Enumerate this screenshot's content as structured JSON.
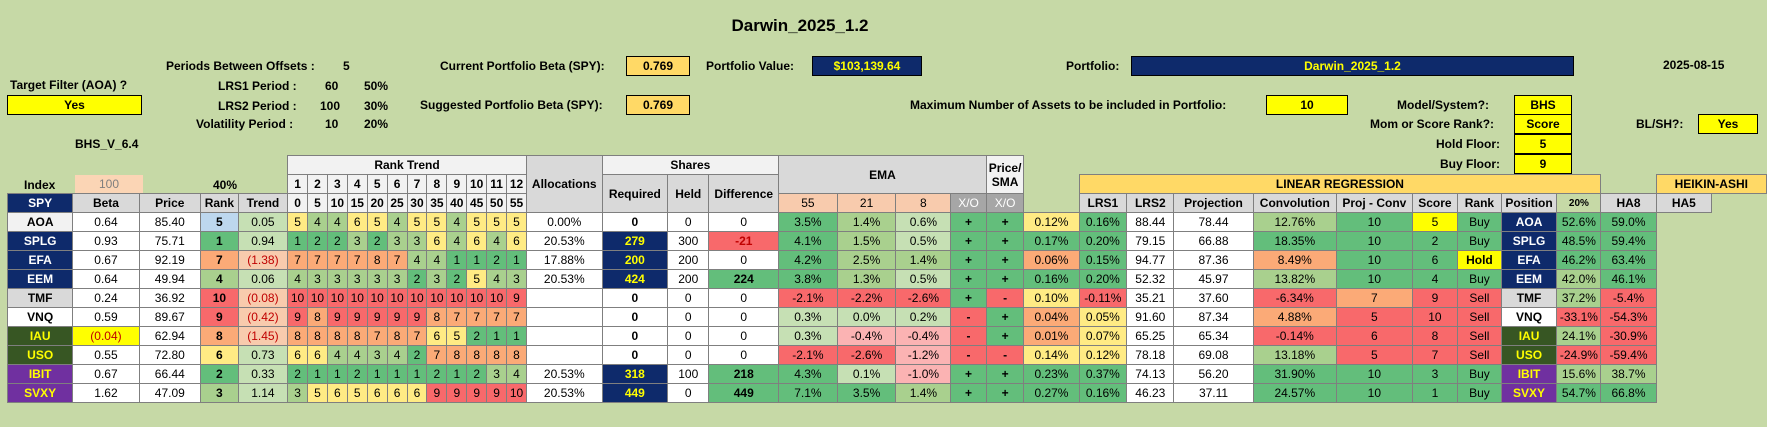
{
  "title": "Darwin_2025_1.2",
  "date": "2025-08-15",
  "target_filter_label": "Target Filter (AOA) ?",
  "target_filter_value": "Yes",
  "version": "BHS_V_6.4",
  "periods_between_offsets_label": "Periods Between Offsets :",
  "periods_between_offsets_value": "5",
  "lrs1_label": "LRS1 Period :",
  "lrs1_period": "60",
  "lrs1_pct": "50%",
  "lrs2_label": "LRS2 Period :",
  "lrs2_period": "100",
  "lrs2_pct": "30%",
  "vol_label": "Volatility Period :",
  "vol_period": "10",
  "vol_pct": "20%",
  "current_beta_label": "Current Portfolio Beta (SPY):",
  "current_beta": "0.769",
  "suggested_beta_label": "Suggested Portfolio Beta (SPY):",
  "suggested_beta": "0.769",
  "portfolio_value_label": "Portfolio Value:",
  "portfolio_value": "$103,139.64",
  "portfolio_label": "Portfolio:",
  "portfolio_name": "Darwin_2025_1.2",
  "max_assets_label": "Maximum Number of Assets to be included in Portfolio:",
  "max_assets": "10",
  "model_label": "Model/System?:",
  "model_value": "BHS",
  "rank_label": "Mom or Score Rank?:",
  "rank_value": "Score",
  "hold_floor_label": "Hold Floor:",
  "hold_floor": "5",
  "buy_floor_label": "Buy Floor:",
  "buy_floor": "9",
  "blsh_label": "BL/SH?:",
  "blsh_value": "Yes",
  "headers": {
    "index": "Index",
    "index_val": "100",
    "pct40": "40%",
    "spy": "SPY",
    "beta": "Beta",
    "price": "Price",
    "rank": "Rank",
    "trend": "Trend",
    "rank_trend": "Rank Trend",
    "rt_nums": [
      "1",
      "2",
      "3",
      "4",
      "5",
      "6",
      "7",
      "8",
      "9",
      "10",
      "11",
      "12"
    ],
    "rt_offsets": [
      "0",
      "5",
      "10",
      "15",
      "20",
      "25",
      "30",
      "35",
      "40",
      "45",
      "50",
      "55"
    ],
    "allocations": "Allocations",
    "shares": "Shares",
    "required": "Required",
    "held": "Held",
    "difference": "Difference",
    "ema": "EMA",
    "ema55": "55",
    "ema21": "21",
    "ema8": "8",
    "xo": "X/O",
    "price_sma": "Price/ SMA",
    "xo2": "X/O",
    "linreg": "LINEAR REGRESSION",
    "lrs1": "LRS1",
    "lrs2": "LRS2",
    "projection": "Projection",
    "convolution": "Convolution",
    "projconv": "Proj - Conv",
    "score": "Score",
    "rank2": "Rank",
    "position": "Position",
    "pct20": "20%",
    "heikin": "HEIKIN-ASHI",
    "ha8": "HA8",
    "ha5": "HA5"
  },
  "rows": [
    {
      "tk": "AOA",
      "beta": "0.64",
      "price": "85.40",
      "rank": "5",
      "trend": "0.05",
      "rt": [
        "5",
        "4",
        "4",
        "6",
        "5",
        "4",
        "5",
        "5",
        "4",
        "5",
        "5",
        "5"
      ],
      "alloc": "0.00%",
      "req": "0",
      "held": "0",
      "diff": "0",
      "e55": "3.5%",
      "e21": "1.4%",
      "e8": "0.6%",
      "xo": "+",
      "ps": "+",
      "l1": "0.12%",
      "l2": "0.16%",
      "proj": "88.44",
      "conv": "78.44",
      "pc": "12.76%",
      "score": "10",
      "rank2": "5",
      "pos": "Buy",
      "tk2": "AOA",
      "ha8": "52.6%",
      "ha5": "59.0%"
    },
    {
      "tk": "SPLG",
      "beta": "0.93",
      "price": "75.71",
      "rank": "1",
      "trend": "0.94",
      "rt": [
        "1",
        "2",
        "2",
        "3",
        "2",
        "3",
        "3",
        "6",
        "4",
        "6",
        "4",
        "6"
      ],
      "alloc": "20.53%",
      "req": "279",
      "held": "300",
      "diff": "-21",
      "e55": "4.1%",
      "e21": "1.5%",
      "e8": "0.5%",
      "xo": "+",
      "ps": "+",
      "l1": "0.17%",
      "l2": "0.20%",
      "proj": "79.15",
      "conv": "66.88",
      "pc": "18.35%",
      "score": "10",
      "rank2": "2",
      "pos": "Buy",
      "tk2": "SPLG",
      "ha8": "48.5%",
      "ha5": "59.4%"
    },
    {
      "tk": "EFA",
      "beta": "0.67",
      "price": "92.19",
      "rank": "7",
      "trend": "(1.38)",
      "rt": [
        "7",
        "7",
        "7",
        "7",
        "8",
        "7",
        "4",
        "4",
        "1",
        "1",
        "2",
        "1"
      ],
      "alloc": "17.88%",
      "req": "200",
      "held": "200",
      "diff": "0",
      "e55": "4.2%",
      "e21": "2.5%",
      "e8": "1.4%",
      "xo": "+",
      "ps": "+",
      "l1": "0.06%",
      "l2": "0.15%",
      "proj": "94.77",
      "conv": "87.36",
      "pc": "8.49%",
      "score": "10",
      "rank2": "6",
      "pos": "Hold",
      "tk2": "EFA",
      "ha8": "46.2%",
      "ha5": "63.4%"
    },
    {
      "tk": "EEM",
      "beta": "0.64",
      "price": "49.94",
      "rank": "4",
      "trend": "0.06",
      "rt": [
        "4",
        "3",
        "3",
        "3",
        "3",
        "3",
        "2",
        "3",
        "2",
        "5",
        "4",
        "3"
      ],
      "alloc": "20.53%",
      "req": "424",
      "held": "200",
      "diff": "224",
      "e55": "3.8%",
      "e21": "1.3%",
      "e8": "0.5%",
      "xo": "+",
      "ps": "+",
      "l1": "0.16%",
      "l2": "0.20%",
      "proj": "52.32",
      "conv": "45.97",
      "pc": "13.82%",
      "score": "10",
      "rank2": "4",
      "pos": "Buy",
      "tk2": "EEM",
      "ha8": "42.0%",
      "ha5": "46.1%"
    },
    {
      "tk": "TMF",
      "beta": "0.24",
      "price": "36.92",
      "rank": "10",
      "trend": "(0.08)",
      "rt": [
        "10",
        "10",
        "10",
        "10",
        "10",
        "10",
        "10",
        "10",
        "10",
        "10",
        "10",
        "9"
      ],
      "alloc": "",
      "req": "0",
      "held": "0",
      "diff": "0",
      "e55": "-2.1%",
      "e21": "-2.2%",
      "e8": "-2.6%",
      "xo": "+",
      "ps": "-",
      "l1": "0.10%",
      "l2": "-0.11%",
      "proj": "35.21",
      "conv": "37.60",
      "pc": "-6.34%",
      "score": "7",
      "rank2": "9",
      "pos": "Sell",
      "tk2": "TMF",
      "ha8": "37.2%",
      "ha5": "-5.4%"
    },
    {
      "tk": "VNQ",
      "beta": "0.59",
      "price": "89.67",
      "rank": "9",
      "trend": "(0.42)",
      "rt": [
        "9",
        "8",
        "9",
        "9",
        "9",
        "9",
        "9",
        "8",
        "7",
        "7",
        "7",
        "7"
      ],
      "alloc": "",
      "req": "0",
      "held": "0",
      "diff": "0",
      "e55": "0.3%",
      "e21": "0.0%",
      "e8": "0.2%",
      "xo": "-",
      "ps": "+",
      "l1": "0.04%",
      "l2": "0.05%",
      "proj": "91.60",
      "conv": "87.34",
      "pc": "4.88%",
      "score": "5",
      "rank2": "10",
      "pos": "Sell",
      "tk2": "VNQ",
      "ha8": "-33.1%",
      "ha5": "-54.3%"
    },
    {
      "tk": "IAU",
      "beta": "(0.04)",
      "price": "62.94",
      "rank": "8",
      "trend": "(1.45)",
      "rt": [
        "8",
        "8",
        "8",
        "8",
        "7",
        "8",
        "7",
        "6",
        "5",
        "2",
        "1",
        "1"
      ],
      "alloc": "",
      "req": "0",
      "held": "0",
      "diff": "0",
      "e55": "0.3%",
      "e21": "-0.4%",
      "e8": "-0.4%",
      "xo": "-",
      "ps": "+",
      "l1": "0.01%",
      "l2": "0.07%",
      "proj": "65.25",
      "conv": "65.34",
      "pc": "-0.14%",
      "score": "6",
      "rank2": "8",
      "pos": "Sell",
      "tk2": "IAU",
      "ha8": "24.1%",
      "ha5": "-30.9%"
    },
    {
      "tk": "USO",
      "beta": "0.55",
      "price": "72.80",
      "rank": "6",
      "trend": "0.73",
      "rt": [
        "6",
        "6",
        "4",
        "4",
        "3",
        "4",
        "2",
        "7",
        "8",
        "8",
        "8",
        "8"
      ],
      "alloc": "",
      "req": "0",
      "held": "0",
      "diff": "0",
      "e55": "-2.1%",
      "e21": "-2.6%",
      "e8": "-1.2%",
      "xo": "-",
      "ps": "-",
      "l1": "0.14%",
      "l2": "0.12%",
      "proj": "78.18",
      "conv": "69.08",
      "pc": "13.18%",
      "score": "5",
      "rank2": "7",
      "pos": "Sell",
      "tk2": "USO",
      "ha8": "-24.9%",
      "ha5": "-59.4%"
    },
    {
      "tk": "IBIT",
      "beta": "0.67",
      "price": "66.44",
      "rank": "2",
      "trend": "0.33",
      "rt": [
        "2",
        "1",
        "1",
        "2",
        "1",
        "1",
        "1",
        "2",
        "1",
        "2",
        "3",
        "4"
      ],
      "alloc": "20.53%",
      "req": "318",
      "held": "100",
      "diff": "218",
      "e55": "4.3%",
      "e21": "0.1%",
      "e8": "-1.0%",
      "xo": "+",
      "ps": "+",
      "l1": "0.23%",
      "l2": "0.37%",
      "proj": "74.13",
      "conv": "56.20",
      "pc": "31.90%",
      "score": "10",
      "rank2": "3",
      "pos": "Buy",
      "tk2": "IBIT",
      "ha8": "15.6%",
      "ha5": "38.7%"
    },
    {
      "tk": "SVXY",
      "beta": "1.62",
      "price": "47.09",
      "rank": "3",
      "trend": "1.14",
      "rt": [
        "3",
        "5",
        "6",
        "5",
        "6",
        "6",
        "6",
        "9",
        "9",
        "9",
        "9",
        "10"
      ],
      "alloc": "20.53%",
      "req": "449",
      "held": "0",
      "diff": "449",
      "e55": "7.1%",
      "e21": "3.5%",
      "e8": "1.4%",
      "xo": "+",
      "ps": "+",
      "l1": "0.27%",
      "l2": "0.16%",
      "proj": "46.23",
      "conv": "37.11",
      "pc": "24.57%",
      "score": "10",
      "rank2": "1",
      "pos": "Buy",
      "tk2": "SVXY",
      "ha8": "54.7%",
      "ha5": "66.8%"
    }
  ]
}
